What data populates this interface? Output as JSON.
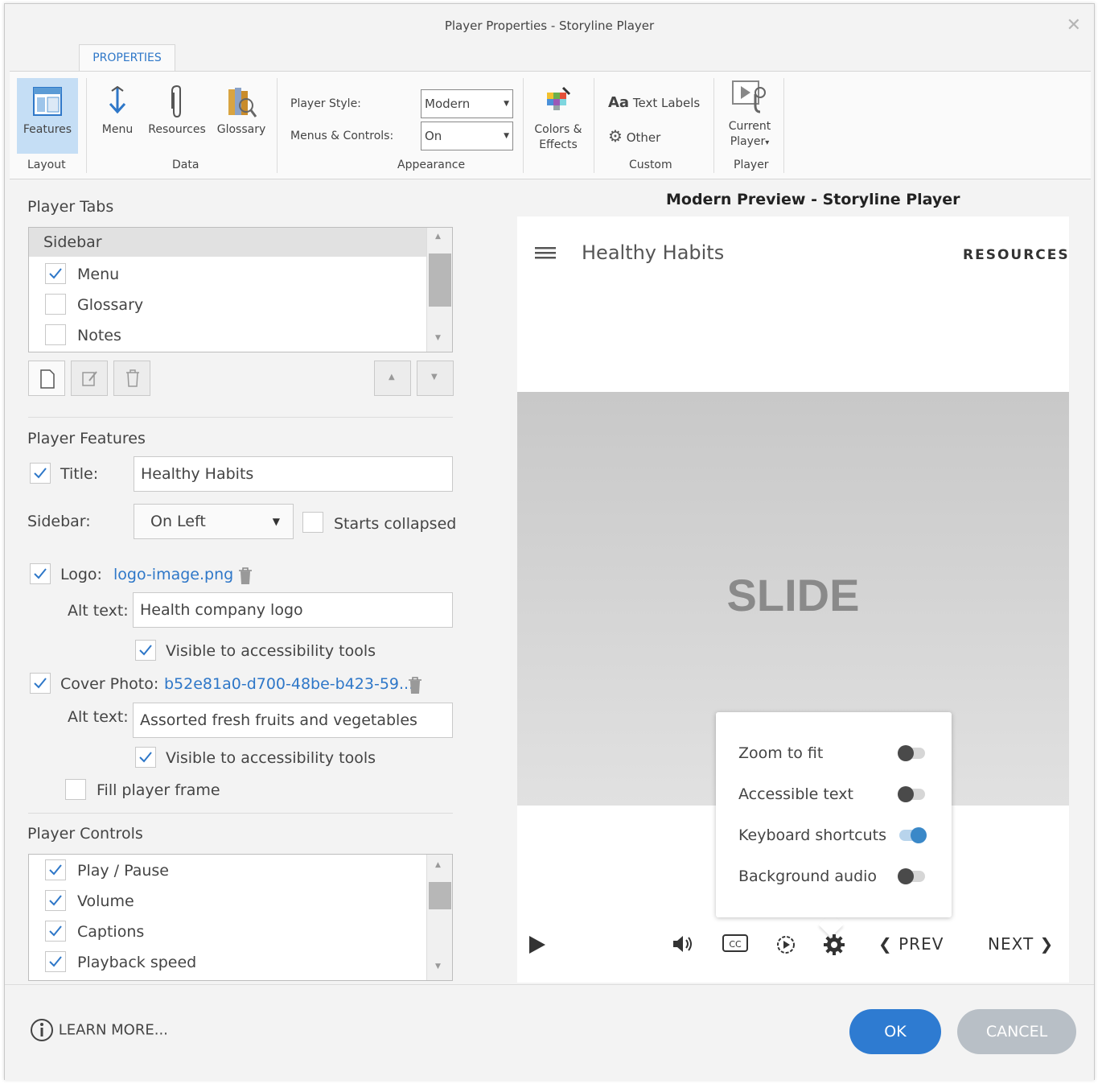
{
  "window": {
    "title": "Player Properties - Storyline Player"
  },
  "ribbon": {
    "tab": "PROPERTIES",
    "features": "Features",
    "menu": "Menu",
    "resources": "Resources",
    "glossary": "Glossary",
    "groups": {
      "layout": "Layout",
      "data": "Data",
      "appearance": "Appearance",
      "custom": "Custom",
      "player": "Player"
    },
    "player_style_label": "Player Style:",
    "player_style_value": "Modern",
    "menus_controls_label": "Menus & Controls:",
    "menus_controls_value": "On",
    "colors_effects_line1": "Colors &",
    "colors_effects_line2": "Effects",
    "text_labels": "Text Labels",
    "text_labels_prefix": "Aa",
    "other": "Other",
    "current_player_line1": "Current",
    "current_player_line2": "Player"
  },
  "player_tabs": {
    "title": "Player Tabs",
    "header": "Sidebar",
    "items": [
      {
        "label": "Menu",
        "checked": true
      },
      {
        "label": "Glossary",
        "checked": false
      },
      {
        "label": "Notes",
        "checked": false
      }
    ]
  },
  "player_features": {
    "title": "Player Features",
    "title_label": "Title:",
    "title_value": "Healthy Habits",
    "sidebar_label": "Sidebar:",
    "sidebar_value": "On Left",
    "starts_collapsed": "Starts collapsed",
    "logo_label": "Logo:",
    "logo_file": "logo-image.png",
    "alt_text_label": "Alt text:",
    "logo_alt": "Health company logo",
    "visible_accessibility": "Visible to accessibility tools",
    "cover_label": "Cover Photo:",
    "cover_file": "b52e81a0-d700-48be-b423-59...",
    "cover_alt": "Assorted fresh fruits and vegetables",
    "fill_frame": "Fill player frame"
  },
  "player_controls": {
    "title": "Player Controls",
    "items": [
      {
        "label": "Play / Pause",
        "checked": true
      },
      {
        "label": "Volume",
        "checked": true
      },
      {
        "label": "Captions",
        "checked": true
      },
      {
        "label": "Playback speed",
        "checked": true
      }
    ]
  },
  "preview": {
    "title": "Modern Preview - Storyline Player",
    "course_title": "Healthy Habits",
    "resources": "RESOURCES",
    "slide": "SLIDE",
    "settings": [
      {
        "label": "Zoom to fit",
        "on": false
      },
      {
        "label": "Accessible text",
        "on": false
      },
      {
        "label": "Keyboard shortcuts",
        "on": true
      },
      {
        "label": "Background audio",
        "on": false
      }
    ],
    "prev": "PREV",
    "next": "NEXT"
  },
  "footer": {
    "learn_more": "LEARN MORE...",
    "ok": "OK",
    "cancel": "CANCEL"
  },
  "colors": {
    "accent": "#2e7bd1",
    "link": "#2e77c8",
    "active_ribbon": "#c5def5"
  }
}
